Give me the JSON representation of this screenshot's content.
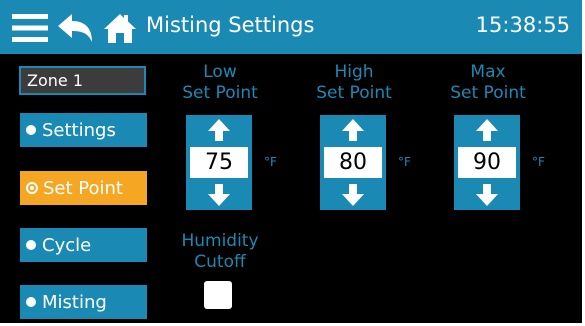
{
  "header": {
    "title": "Misting Settings",
    "time": "15:38:55",
    "icons": {
      "menu": "hamburger-menu-icon",
      "back": "back-arrow-icon",
      "home": "home-icon"
    }
  },
  "zone": {
    "label": "Zone 1"
  },
  "nav": {
    "items": [
      {
        "label": "Settings",
        "active": false
      },
      {
        "label": "Set Point",
        "active": true
      },
      {
        "label": "Cycle",
        "active": false
      },
      {
        "label": "Misting",
        "active": false
      }
    ]
  },
  "setpoints": [
    {
      "label_line1": "Low",
      "label_line2": "Set Point",
      "value": "75",
      "unit": "°F"
    },
    {
      "label_line1": "High",
      "label_line2": "Set Point",
      "value": "80",
      "unit": "°F"
    },
    {
      "label_line1": "Max",
      "label_line2": "Set Point",
      "value": "90",
      "unit": "°F"
    }
  ],
  "humidity": {
    "label_line1": "Humidity",
    "label_line2": "Cutoff",
    "checked": false
  },
  "colors": {
    "accent": "#1a8ab5",
    "active": "#f5a623",
    "background": "#000000"
  }
}
